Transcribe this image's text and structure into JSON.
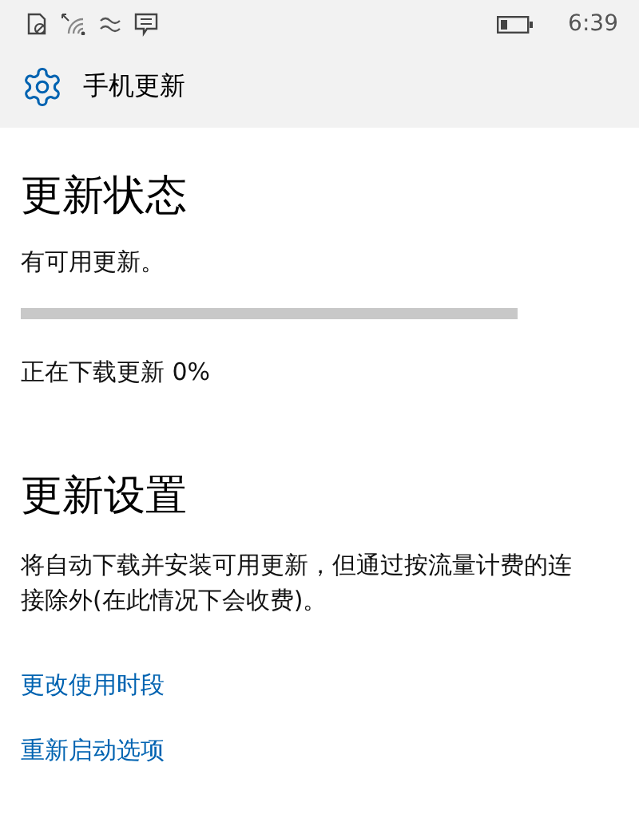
{
  "status_bar": {
    "time": "6:39"
  },
  "header": {
    "title": "手机更新"
  },
  "update_status": {
    "heading": "更新状态",
    "message": "有可用更新。",
    "progress_text": "正在下载更新 0%"
  },
  "update_settings": {
    "heading": "更新设置",
    "description": "将自动下载并安装可用更新，但通过按流量计费的连接除外(在此情况下会收费)。",
    "links": [
      {
        "label": "更改使用时段"
      },
      {
        "label": "重新启动选项"
      }
    ]
  }
}
